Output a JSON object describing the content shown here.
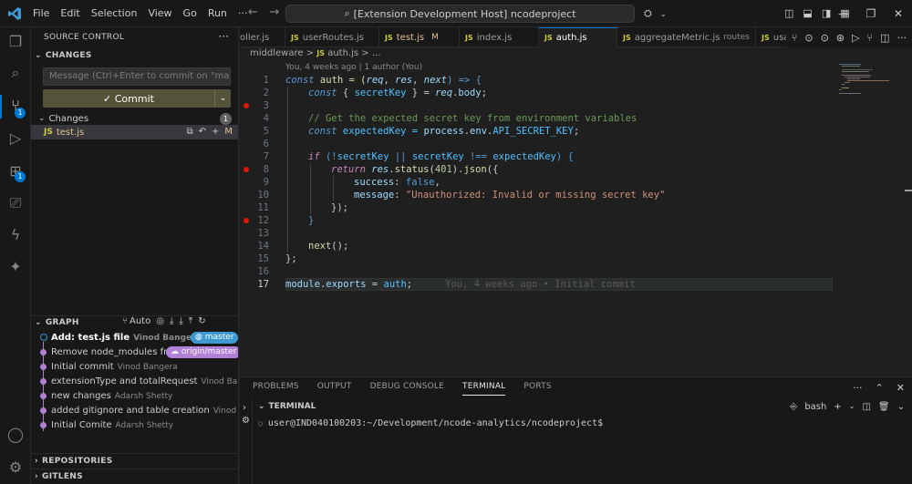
{
  "titlebar": {
    "menu": [
      "File",
      "Edit",
      "Selection",
      "View",
      "Go",
      "Run",
      "···"
    ],
    "search": "[Extension Development Host] ncodeproject"
  },
  "activity": {
    "icons": [
      "explorer-icon",
      "search-icon",
      "source-control-icon",
      "run-debug-icon",
      "extensions-icon",
      "remote-explorer-icon",
      "thunder-icon",
      "copilot-icon",
      "account-icon",
      "settings-gear-icon"
    ],
    "scm_badge": "1",
    "ext_badge": "1"
  },
  "sidebar": {
    "title": "SOURCE CONTROL",
    "changes_header": "CHANGES",
    "commit_placeholder": "Message (Ctrl+Enter to commit on \"mast...",
    "commit_label": "✓ Commit",
    "changes_group": "Changes",
    "changes_count": "1",
    "file": {
      "name": "test.js",
      "status": "M"
    },
    "graph_header": "GRAPH",
    "graph_auto": "Auto",
    "graph": [
      {
        "message": "Add: test.js file",
        "author": "Vinod Bangera",
        "tag": "master"
      },
      {
        "message": "Remove node_modules fro...",
        "author": "",
        "tag": "origin/master"
      },
      {
        "message": "Initial commit",
        "author": "Vinod Bangera",
        "tag": ""
      },
      {
        "message": "extensionType and totalRequest",
        "author": "Vinod Ban...",
        "tag": ""
      },
      {
        "message": "new changes",
        "author": "Adarsh Shetty",
        "tag": ""
      },
      {
        "message": "added gitignore and table creation",
        "author": "Vinod B...",
        "tag": ""
      },
      {
        "message": "Initial Comite",
        "author": "Adarsh Shetty",
        "tag": ""
      }
    ],
    "repositories": "REPOSITORIES",
    "gitlens": "GITLENS"
  },
  "tabs": [
    {
      "label": "oller.js",
      "mod": "",
      "dim": ""
    },
    {
      "label": "userRoutes.js",
      "mod": "",
      "dim": ""
    },
    {
      "label": "test.js",
      "mod": "M",
      "dim": ""
    },
    {
      "label": "index.js",
      "mod": "",
      "dim": ""
    },
    {
      "label": "auth.js",
      "mod": "",
      "dim": ""
    },
    {
      "label": "aggregateMetric.js",
      "mod": "",
      "dim": "routes"
    },
    {
      "label": "usage",
      "mod": "",
      "dim": ""
    }
  ],
  "editor": {
    "breadcrumb": [
      "middleware",
      ">",
      "auth.js",
      ">",
      "..."
    ],
    "blame_header": "You, 4 weeks ago | 1 author (You)",
    "inline_blame": "You, 4 weeks ago • Initial commit",
    "line_numbers": [
      "1",
      "2",
      "3",
      "4",
      "5",
      "6",
      "7",
      "8",
      "9",
      "10",
      "11",
      "12",
      "13",
      "14",
      "15",
      "16",
      "17"
    ],
    "lines": {
      "l1": {
        "a": "const",
        "b": " auth = (",
        "c": "req",
        "d": ", ",
        "e": "res",
        "f": ", ",
        "g": "next",
        "h": ") => {"
      },
      "l2": {
        "a": "const",
        "b": " { ",
        "c": "secretKey",
        "d": " } = ",
        "e": "req",
        "f": ".",
        "g": "body",
        "h": ";"
      },
      "l4": "// Get the expected secret key from environment variables",
      "l5": {
        "a": "const",
        "b": " expectedKey = ",
        "c": "process",
        "d": ".",
        "e": "env",
        "f": ".",
        "g": "API_SECRET_KEY",
        "h": ";"
      },
      "l7": {
        "a": "if",
        "b": " (!",
        "c": "secretKey",
        "d": " || ",
        "e": "secretKey",
        "f": " !== ",
        "g": "expectedKey",
        "h": ") {"
      },
      "l8": {
        "a": "return",
        "b": " ",
        "c": "res",
        "d": ".",
        "e": "status",
        "f": "(",
        "g": "401",
        "h": ").",
        "i": "json",
        "j": "({"
      },
      "l9": {
        "a": "success",
        "b": ": ",
        "c": "false",
        "d": ","
      },
      "l10": {
        "a": "message",
        "b": ": ",
        "c": "\"Unauthorized: Invalid or missing secret key\""
      },
      "l11": "});",
      "l12": "}",
      "l14": {
        "a": "next",
        "b": "();"
      },
      "l15": "};",
      "l17": {
        "a": "module",
        "b": ".",
        "c": "exports",
        "d": " = ",
        "e": "auth",
        "f": ";"
      }
    }
  },
  "panel": {
    "tabs": [
      "PROBLEMS",
      "OUTPUT",
      "DEBUG CONSOLE",
      "TERMINAL",
      "PORTS"
    ],
    "terminal_label": "TERMINAL",
    "shell": "bash",
    "prompt": "user@IND040100203:~/Development/ncode-analytics/ncodeproject$"
  }
}
